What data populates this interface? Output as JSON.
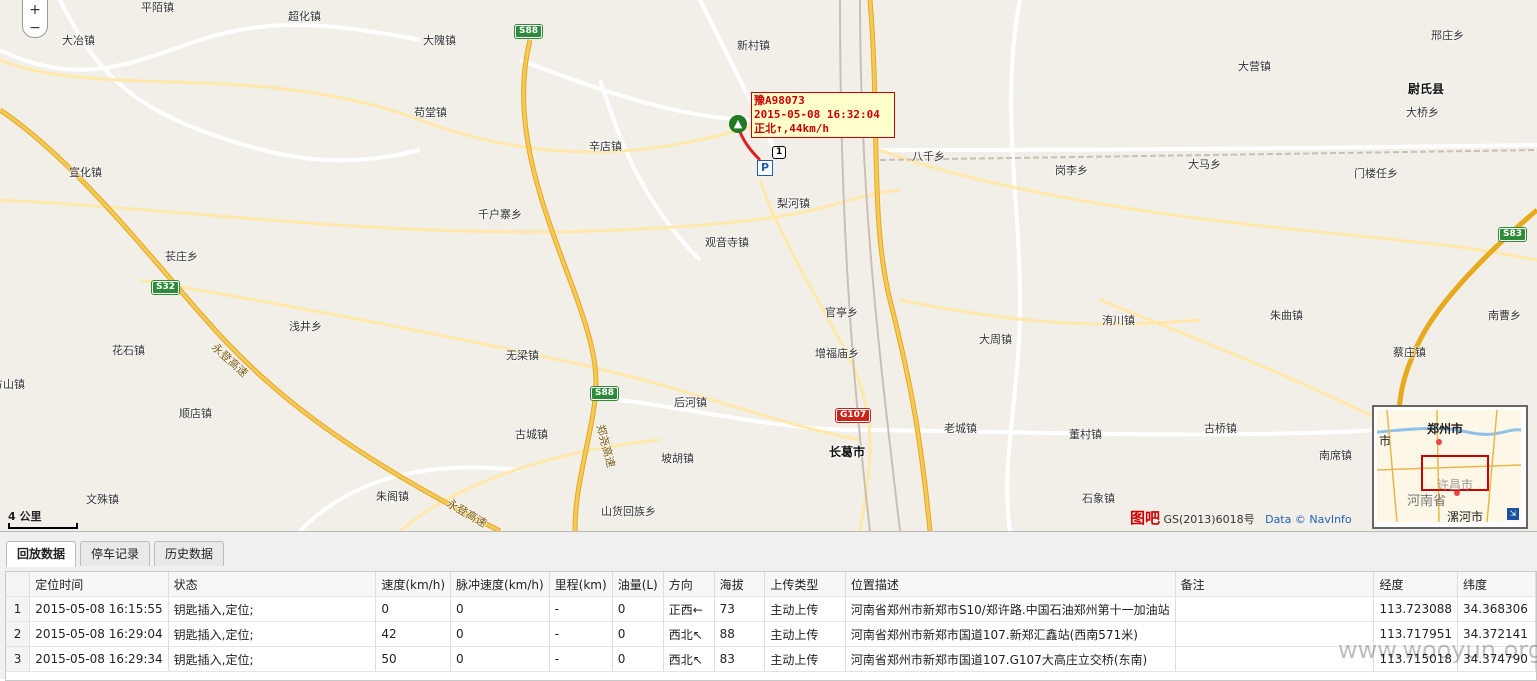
{
  "map": {
    "zoom_plus": "+",
    "zoom_minus": "−",
    "scale_label": "4 公里",
    "places": [
      {
        "name": "平陌镇",
        "type": "town"
      },
      {
        "name": "超化镇",
        "type": "town"
      },
      {
        "name": "大冶镇",
        "type": "town"
      },
      {
        "name": "大隗镇",
        "type": "town"
      },
      {
        "name": "新村镇",
        "type": "town"
      },
      {
        "name": "邢庄乡",
        "type": "town"
      },
      {
        "name": "大营镇",
        "type": "town"
      },
      {
        "name": "尉氏县",
        "type": "city"
      },
      {
        "name": "苟堂镇",
        "type": "town"
      },
      {
        "name": "大桥乡",
        "type": "town"
      },
      {
        "name": "辛店镇",
        "type": "town"
      },
      {
        "name": "八千乡",
        "type": "town"
      },
      {
        "name": "宣化镇",
        "type": "town"
      },
      {
        "name": "岗李乡",
        "type": "town"
      },
      {
        "name": "大马乡",
        "type": "town"
      },
      {
        "name": "门楼任乡",
        "type": "town"
      },
      {
        "name": "梨河镇",
        "type": "town"
      },
      {
        "name": "千户寨乡",
        "type": "town"
      },
      {
        "name": "观音寺镇",
        "type": "town"
      },
      {
        "name": "苌庄乡",
        "type": "town"
      },
      {
        "name": "官亭乡",
        "type": "town"
      },
      {
        "name": "朱曲镇",
        "type": "town"
      },
      {
        "name": "南曹乡",
        "type": "town"
      },
      {
        "name": "浅井乡",
        "type": "town"
      },
      {
        "name": "洧川镇",
        "type": "town"
      },
      {
        "name": "大周镇",
        "type": "town"
      },
      {
        "name": "花石镇",
        "type": "town"
      },
      {
        "name": "增福庙乡",
        "type": "town"
      },
      {
        "name": "蔡庄镇",
        "type": "town"
      },
      {
        "name": "无梁镇",
        "type": "town"
      },
      {
        "name": "方山镇",
        "type": "town"
      },
      {
        "name": "后河镇",
        "type": "town"
      },
      {
        "name": "顺店镇",
        "type": "town"
      },
      {
        "name": "古城镇",
        "type": "town"
      },
      {
        "name": "老城镇",
        "type": "town"
      },
      {
        "name": "董村镇",
        "type": "town"
      },
      {
        "name": "古桥镇",
        "type": "town"
      },
      {
        "name": "长葛市",
        "type": "city"
      },
      {
        "name": "坡胡镇",
        "type": "town"
      },
      {
        "name": "南席镇",
        "type": "town"
      },
      {
        "name": "文殊镇",
        "type": "town"
      },
      {
        "name": "朱阁镇",
        "type": "town"
      },
      {
        "name": "石象镇",
        "type": "town"
      },
      {
        "name": "山货回族乡",
        "type": "town"
      }
    ],
    "shields": [
      {
        "label": "S88",
        "color": "#2e8b3a"
      },
      {
        "label": "S32",
        "color": "#2e8b3a"
      },
      {
        "label": "S88",
        "color": "#2e8b3a"
      },
      {
        "label": "S83",
        "color": "#2e8b3a"
      },
      {
        "label": "G107",
        "color": "#c8241a"
      },
      {
        "label": "1",
        "color": "#000000"
      }
    ],
    "road_names": [
      "永登高速",
      "郑尧高速",
      "永登高速"
    ],
    "vehicle_tooltip": {
      "plate": "豫A98073",
      "time": "2015-05-08 16:32:04",
      "status": "正北↑,44km/h"
    },
    "parking_label": "P",
    "attribution": {
      "logo": "图吧",
      "license": "GS(2013)6018号",
      "data": "Data © NavInfo"
    },
    "minimap": {
      "city1": "郑州市",
      "city2": "许昌市",
      "province": "河南省",
      "city3": "漯河市",
      "edge": "市"
    }
  },
  "panel": {
    "tabs": [
      {
        "label": "回放数据",
        "active": true
      },
      {
        "label": "停车记录",
        "active": false
      },
      {
        "label": "历史数据",
        "active": false
      }
    ],
    "columns": [
      "",
      "定位时间",
      "状态",
      "速度(km/h)",
      "脉冲速度(km/h)",
      "里程(km)",
      "油量(L)",
      "方向",
      "海拔",
      "上传类型",
      "位置描述",
      "备注",
      "经度",
      "纬度"
    ],
    "rows": [
      [
        "1",
        "2015-05-08 16:15:55",
        "钥匙插入,定位;",
        "0",
        "0",
        "-",
        "0",
        "正西←",
        "73",
        "主动上传",
        "河南省郑州市新郑市S10/郑许路.中国石油郑州第十一加油站",
        "",
        "113.723088",
        "34.368306"
      ],
      [
        "2",
        "2015-05-08 16:29:04",
        "钥匙插入,定位;",
        "42",
        "0",
        "-",
        "0",
        "西北↖",
        "88",
        "主动上传",
        "河南省郑州市新郑市国道107.新郑汇鑫站(西南571米)",
        "",
        "113.717951",
        "34.372141"
      ],
      [
        "3",
        "2015-05-08 16:29:34",
        "钥匙插入,定位;",
        "50",
        "0",
        "-",
        "0",
        "西北↖",
        "83",
        "主动上传",
        "河南省郑州市新郑市国道107.G107大高庄立交桥(东南)",
        "",
        "113.715018",
        "34.374790"
      ]
    ]
  },
  "watermark": "www.wooyun.org"
}
